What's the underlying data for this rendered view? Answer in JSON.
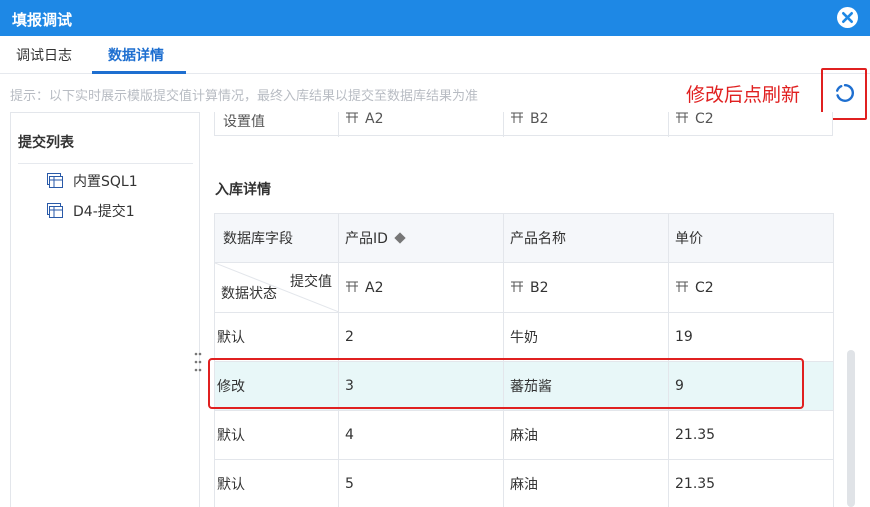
{
  "dialog": {
    "title": "填报调试"
  },
  "tabs": [
    {
      "label": "调试日志",
      "active": false
    },
    {
      "label": "数据详情",
      "active": true
    }
  ],
  "hint": "提示：以下实时展示模版提交值计算情况，最终入库结果以提交至数据库结果为准",
  "annotation": "修改后点刷新",
  "left_panel": {
    "title": "提交列表",
    "items": [
      {
        "label": "内置SQL1",
        "icon": "table-icon"
      },
      {
        "label": "D4-提交1",
        "icon": "table-icon"
      }
    ]
  },
  "top_table": {
    "first_cell": "设置值",
    "cells": [
      "A2",
      "B2",
      "C2"
    ]
  },
  "section_title": "入库详情",
  "detail_table": {
    "header": [
      "数据库字段",
      "产品ID",
      "产品名称",
      "单价"
    ],
    "subheader": {
      "corner_top": "提交值",
      "corner_bottom": "数据状态",
      "cells": [
        "A2",
        "B2",
        "C2"
      ]
    },
    "rows": [
      {
        "state": "默认",
        "cells": [
          "2",
          "牛奶",
          "19"
        ],
        "highlight": false
      },
      {
        "state": "修改",
        "cells": [
          "3",
          "蕃茄酱",
          "9"
        ],
        "highlight": true
      },
      {
        "state": "默认",
        "cells": [
          "4",
          "麻油",
          "21.35"
        ],
        "highlight": false
      },
      {
        "state": "默认",
        "cells": [
          "5",
          "麻油",
          "21.35"
        ],
        "highlight": false
      }
    ]
  },
  "colors": {
    "titlebar": "#1e88e5",
    "accent": "#1e6fd0",
    "annotation": "#e02020",
    "modified_value": "#28b446",
    "highlight_row": "#e8f7f8"
  }
}
